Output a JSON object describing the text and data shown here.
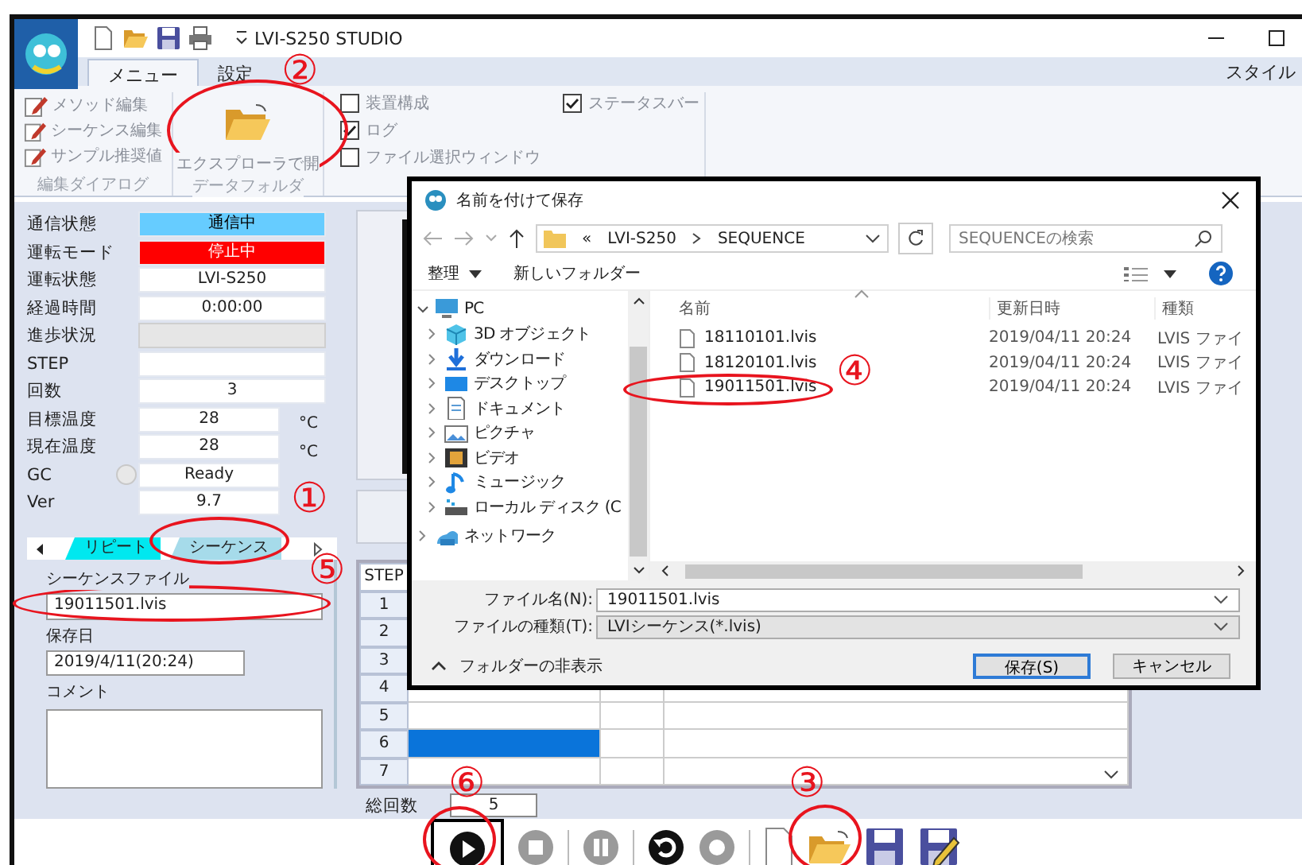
{
  "window": {
    "title": "LVI-S250 STUDIO",
    "right_label": "スタイル"
  },
  "ribbon": {
    "tabs": [
      {
        "label": "メニュー",
        "selected": true
      },
      {
        "label": "設定",
        "selected": false
      }
    ],
    "groups": [
      {
        "kind": "list",
        "label": "編集ダイアログ",
        "items": [
          "メソッド編集",
          "シーケンス編集",
          "サンプル推奨値"
        ]
      },
      {
        "kind": "big",
        "label": "データフォルダ",
        "button": "エクスプローラで開"
      },
      {
        "kind": "checks",
        "columns": [
          [
            {
              "label": "装置構成",
              "checked": false
            },
            {
              "label": "ログ",
              "checked": true
            },
            {
              "label": "ファイル選択ウィンドウ",
              "checked": false
            }
          ],
          [
            {
              "label": "ステータスバー",
              "checked": true
            }
          ]
        ]
      }
    ]
  },
  "status_panel": [
    {
      "label": "通信状態",
      "kind": "field",
      "value": "通信中",
      "color": "#66ccff"
    },
    {
      "label": "運転モード",
      "kind": "field",
      "value": "停止中",
      "color": "#ff0000"
    },
    {
      "label": "運転状態",
      "kind": "field",
      "value": "LVI-S250"
    },
    {
      "label": "経過時間",
      "kind": "field",
      "value": "0:00:00"
    },
    {
      "label": "進歩状況",
      "kind": "progress",
      "level": 0
    },
    {
      "label": "STEP",
      "kind": "field"
    },
    {
      "label": "回数",
      "kind": "field",
      "value": "3"
    },
    {
      "label": "目標温度",
      "kind": "short",
      "value": "28",
      "unit": "°C"
    },
    {
      "label": "現在温度",
      "kind": "short",
      "value": "28",
      "unit": "°C"
    },
    {
      "label": "GC",
      "kind": "lamp",
      "lit": false,
      "value": "Ready"
    },
    {
      "label": "Ver",
      "kind": "short",
      "value": "9.7"
    }
  ],
  "side_tabs": [
    {
      "label": "リピート",
      "selected": false
    },
    {
      "label": "シーケンス",
      "selected": true
    }
  ],
  "sequence": {
    "file_label": "シーケンスファイル",
    "file": "19011501.lvis",
    "date_label": "保存日",
    "date": "2019/4/11(20:24)",
    "comment_label": "コメント"
  },
  "table": {
    "header": "STEP",
    "rows": [
      {
        "step": "1"
      },
      {
        "step": "2"
      },
      {
        "step": "3"
      },
      {
        "step": "4",
        "selected": false
      },
      {
        "step": "5",
        "selected": false
      },
      {
        "step": "6",
        "selected": true
      },
      {
        "step": "7",
        "selected": false
      }
    ]
  },
  "total": {
    "label": "総回数",
    "value": "5"
  },
  "toolbar": [
    {
      "kind": "play",
      "disabled": false
    },
    {
      "kind": "stop",
      "disabled": true
    },
    {
      "kind": "separator"
    },
    {
      "kind": "pause",
      "disabled": true
    },
    {
      "kind": "separator"
    },
    {
      "kind": "undo",
      "disabled": false
    },
    {
      "kind": "record",
      "disabled": true
    },
    {
      "kind": "separator"
    },
    {
      "kind": "new",
      "disabled": false
    },
    {
      "kind": "open",
      "disabled": false
    },
    {
      "kind": "save",
      "disabled": false
    },
    {
      "kind": "save_edit",
      "disabled": false
    }
  ],
  "dialog": {
    "title": "名前を付けて保存",
    "path_prefix": "«",
    "path": [
      "LVI-S250",
      "SEQUENCE"
    ],
    "search_placeholder": "SEQUENCEの検索",
    "organize": "整理",
    "new_folder": "新しいフォルダー",
    "tree": [
      {
        "label": "PC",
        "kind": "pc",
        "expanded": true,
        "children": [
          {
            "label": "3D オブジェクト",
            "kind": "cube",
            "expanded": false
          },
          {
            "label": "ダウンロード",
            "kind": "download",
            "expanded": false
          },
          {
            "label": "デスクトップ",
            "kind": "desktop",
            "expanded": false
          },
          {
            "label": "ドキュメント",
            "kind": "document",
            "expanded": false
          },
          {
            "label": "ピクチャ",
            "kind": "picture",
            "expanded": false
          },
          {
            "label": "ビデオ",
            "kind": "video",
            "expanded": false
          },
          {
            "label": "ミュージック",
            "kind": "music",
            "expanded": false
          },
          {
            "label": "ローカル ディスク (C",
            "kind": "drive",
            "expanded": false
          }
        ]
      },
      {
        "label": "ネットワーク",
        "kind": "network",
        "expanded": false
      }
    ],
    "columns": [
      "名前",
      "更新日時",
      "種類"
    ],
    "files": [
      {
        "name": "18110101.lvis",
        "date": "2019/04/11 20:24",
        "type": "LVIS ファイ"
      },
      {
        "name": "18120101.lvis",
        "date": "2019/04/11 20:24",
        "type": "LVIS ファイ"
      },
      {
        "name": "19011501.lvis",
        "date": "2019/04/11 20:24",
        "type": "LVIS ファイ"
      }
    ],
    "filename_label": "ファイル名(N):",
    "filename": "19011501.lvis",
    "filetype_label": "ファイルの種類(T):",
    "filetype": "LVIシーケンス(*.lvis)",
    "hide_folders": "フォルダーの非表示",
    "buttons": [
      {
        "label": "保存(S)",
        "default": true
      },
      {
        "label": "キャンセル",
        "default": false
      }
    ]
  },
  "annotations": [
    "②",
    "④",
    "①",
    "⑤",
    "⑥",
    "③"
  ]
}
